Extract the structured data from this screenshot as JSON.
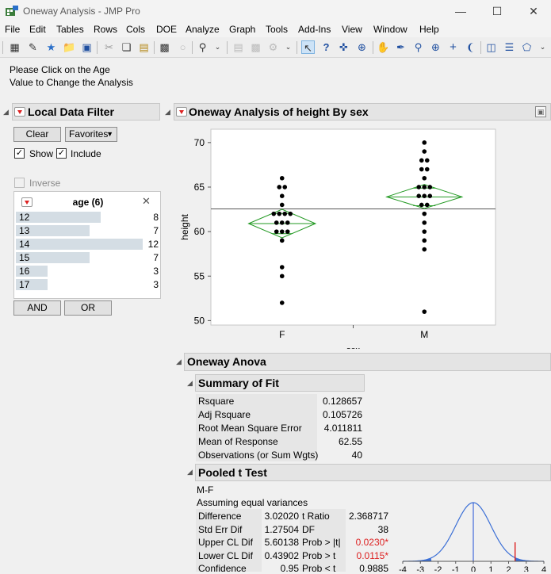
{
  "window": {
    "title": "Oneway Analysis - JMP Pro"
  },
  "menu": [
    "File",
    "Edit",
    "Tables",
    "Rows",
    "Cols",
    "DOE",
    "Analyze",
    "Graph",
    "Tools",
    "Add-Ins",
    "View",
    "Window",
    "Help"
  ],
  "hint": {
    "line1": "Please Click on the Age",
    "line2": "Value to Change the Analysis"
  },
  "local_filter": {
    "title": "Local Data Filter",
    "clear_label": "Clear",
    "favorites_label": "Favorites",
    "show_label": "Show",
    "include_label": "Include",
    "inverse_label": "Inverse",
    "column_title": "age (6)",
    "rows": [
      {
        "label": "12",
        "count": "8",
        "fraction": 0.6667
      },
      {
        "label": "13",
        "count": "7",
        "fraction": 0.5833
      },
      {
        "label": "14",
        "count": "12",
        "fraction": 1.0
      },
      {
        "label": "15",
        "count": "7",
        "fraction": 0.5833
      },
      {
        "label": "16",
        "count": "3",
        "fraction": 0.25
      },
      {
        "label": "17",
        "count": "3",
        "fraction": 0.25
      }
    ],
    "and_label": "AND",
    "or_label": "OR"
  },
  "oneway": {
    "title": "Oneway Analysis of height By sex"
  },
  "chart_data": {
    "type": "scatter",
    "xlabel": "sex",
    "ylabel": "height",
    "categories": [
      "F",
      "M"
    ],
    "ylim": [
      49.5,
      71.5
    ],
    "yticks": [
      50,
      55,
      60,
      65,
      70
    ],
    "grand_mean": 62.55,
    "points": {
      "F": [
        66,
        65,
        65,
        64,
        63,
        62,
        62,
        62,
        62,
        61,
        61,
        61,
        60,
        60,
        60,
        59,
        56,
        55,
        52
      ],
      "M": [
        70,
        69,
        68,
        68,
        67,
        67,
        66,
        65,
        65,
        65,
        64,
        64,
        64,
        63,
        63,
        62,
        61,
        60,
        59,
        58,
        51
      ]
    },
    "means_diamonds": {
      "F": {
        "mean": 60.9,
        "lower": 59.3,
        "upper": 62.5,
        "width": 0.47
      },
      "M": {
        "mean": 63.9,
        "lower": 62.6,
        "upper": 65.3,
        "width": 0.53
      }
    },
    "colors": {
      "points": "#000000",
      "diamond": "#229922",
      "grand_mean": "#555555"
    }
  },
  "oneway_anova": {
    "title": "Oneway Anova"
  },
  "summary_of_fit": {
    "title": "Summary of Fit",
    "rows": [
      {
        "label": "Rsquare",
        "value": "0.128657"
      },
      {
        "label": "Adj Rsquare",
        "value": "0.105726"
      },
      {
        "label": "Root Mean Square Error",
        "value": "4.011811"
      },
      {
        "label": "Mean of Response",
        "value": "62.55"
      },
      {
        "label": "Observations (or Sum Wgts)",
        "value": "40"
      }
    ]
  },
  "pooled_t_test": {
    "title": "Pooled t Test",
    "subtitle1": "M-F",
    "subtitle2": "Assuming equal variances",
    "left_rows": [
      {
        "label": "Difference",
        "value": "3.02020"
      },
      {
        "label": "Std Err Dif",
        "value": "1.27504"
      },
      {
        "label": "Upper CL Dif",
        "value": "5.60138"
      },
      {
        "label": "Lower CL Dif",
        "value": "0.43902"
      },
      {
        "label": "Confidence",
        "value": "0.95"
      }
    ],
    "right_rows": [
      {
        "label": "t Ratio",
        "value": "2.368717",
        "red": false
      },
      {
        "label": "DF",
        "value": "38",
        "red": false
      },
      {
        "label": "Prob > |t|",
        "value": "0.0230*",
        "red": true
      },
      {
        "label": "Prob > t",
        "value": "0.0115*",
        "red": true
      },
      {
        "label": "Prob < t",
        "value": "0.9885",
        "red": false
      }
    ],
    "t_axis_ticks": [
      "-4",
      "-3",
      "-2",
      "-1",
      "0",
      "1",
      "2",
      "3",
      "4"
    ],
    "t_value": 2.368717,
    "df": 38
  }
}
